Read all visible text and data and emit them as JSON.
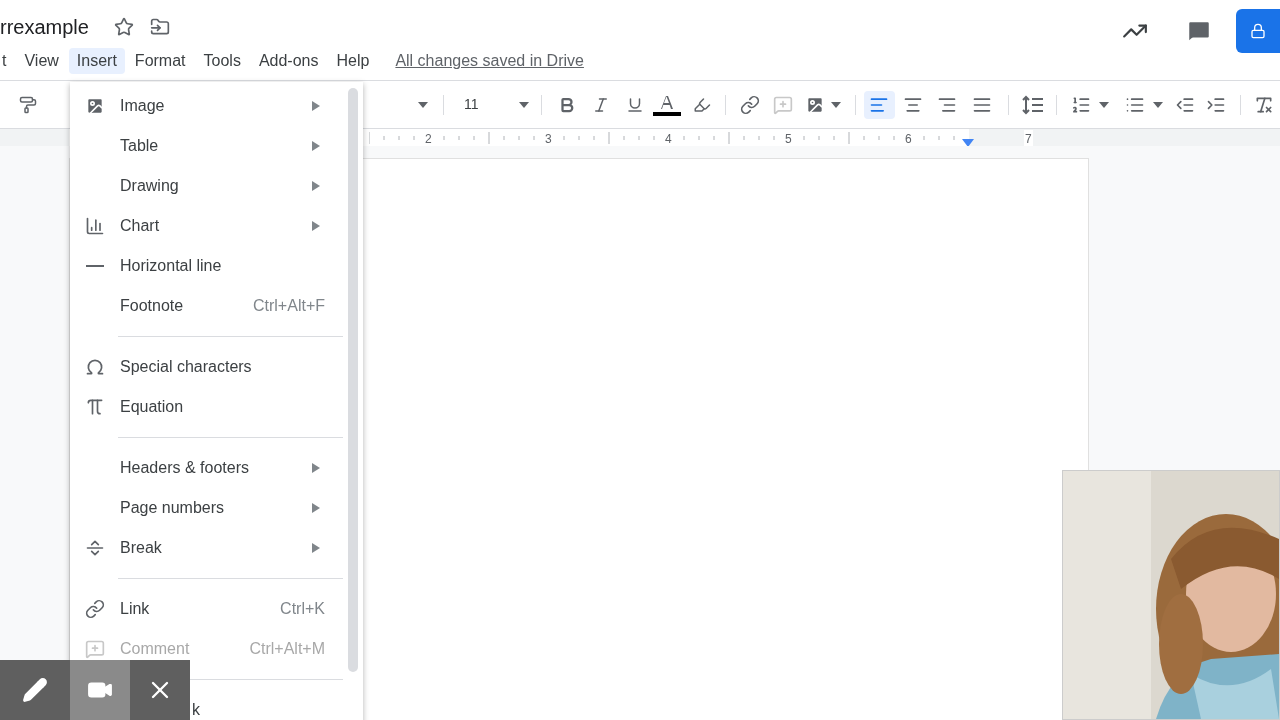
{
  "title": "rrexample",
  "menus": [
    {
      "label": "t",
      "selected": false
    },
    {
      "label": "View",
      "selected": false
    },
    {
      "label": "Insert",
      "selected": true
    },
    {
      "label": "Format",
      "selected": false
    },
    {
      "label": "Tools",
      "selected": false
    },
    {
      "label": "Add-ons",
      "selected": false
    },
    {
      "label": "Help",
      "selected": false
    }
  ],
  "save_status": "All changes saved in Drive",
  "toolbar": {
    "font_size": "11",
    "alignments": [
      {
        "selected": true
      },
      {
        "selected": false
      },
      {
        "selected": false
      },
      {
        "selected": false
      }
    ]
  },
  "ruler": [
    "2",
    "3",
    "4",
    "5",
    "6",
    "7"
  ],
  "insert_menu": [
    {
      "kind": "item",
      "label": "Image",
      "submenu": true,
      "disabled": false
    },
    {
      "kind": "item",
      "label": "Table",
      "submenu": true,
      "disabled": false
    },
    {
      "kind": "item",
      "label": "Drawing",
      "submenu": true,
      "disabled": false
    },
    {
      "kind": "item",
      "label": "Chart",
      "submenu": true,
      "disabled": false
    },
    {
      "kind": "item",
      "label": "Horizontal line",
      "submenu": false,
      "disabled": false
    },
    {
      "kind": "item",
      "label": "Footnote",
      "shortcut": "Ctrl+Alt+F",
      "submenu": false,
      "disabled": false
    },
    {
      "kind": "separator"
    },
    {
      "kind": "item",
      "label": "Special characters",
      "submenu": false,
      "disabled": false
    },
    {
      "kind": "item",
      "label": "Equation",
      "submenu": false,
      "disabled": false
    },
    {
      "kind": "separator"
    },
    {
      "kind": "item",
      "label": "Headers & footers",
      "submenu": true,
      "disabled": false
    },
    {
      "kind": "item",
      "label": "Page numbers",
      "submenu": true,
      "disabled": false
    },
    {
      "kind": "item",
      "label": "Break",
      "submenu": true,
      "disabled": false
    },
    {
      "kind": "separator"
    },
    {
      "kind": "item",
      "label": "Link",
      "shortcut": "Ctrl+K",
      "submenu": false,
      "disabled": false
    },
    {
      "kind": "item",
      "label": "Comment",
      "shortcut": "Ctrl+Alt+M",
      "submenu": false,
      "disabled": true
    },
    {
      "kind": "separator"
    },
    {
      "kind": "cut",
      "label": "k"
    }
  ]
}
